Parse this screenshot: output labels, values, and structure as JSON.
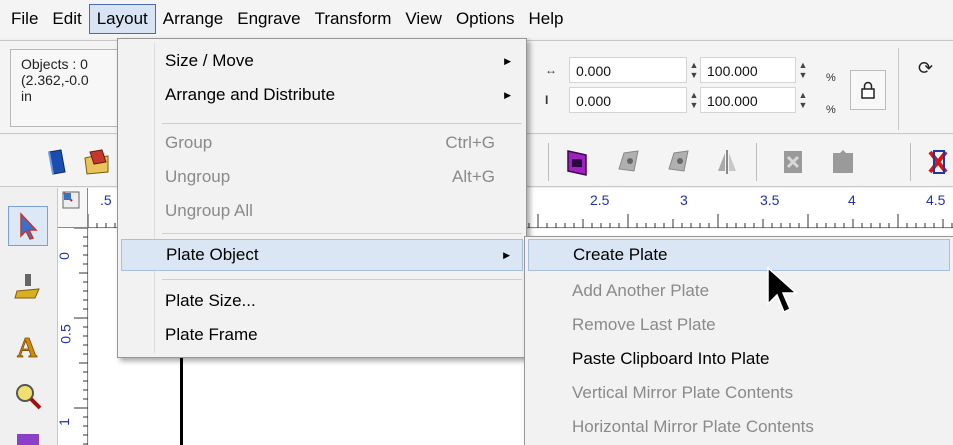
{
  "menubar": {
    "items": [
      "File",
      "Edit",
      "Layout",
      "Arrange",
      "Engrave",
      "Transform",
      "View",
      "Options",
      "Help"
    ],
    "active": "Layout"
  },
  "propbar": {
    "objects_line1": "Objects : 0",
    "objects_line2": "(2.362,-0.0",
    "objects_line3": "in",
    "x_value": "0.000",
    "y_value": "0.000",
    "w_value": "100.000",
    "h_value": "100.000",
    "percent": "%"
  },
  "ruler": {
    "top_labels": [
      ".5",
      "2.5",
      "3",
      "3.5",
      "4",
      "4.5"
    ],
    "left_labels": [
      "0",
      "0.5",
      "1"
    ]
  },
  "layout_menu": {
    "items": [
      {
        "label": "Size / Move",
        "submenu": true
      },
      {
        "label": "Arrange and Distribute",
        "submenu": true
      },
      {
        "label": "Group",
        "shortcut": "Ctrl+G",
        "disabled": true
      },
      {
        "label": "Ungroup",
        "shortcut": "Alt+G",
        "disabled": true
      },
      {
        "label": "Ungroup All",
        "disabled": true
      },
      {
        "label": "Plate Object",
        "submenu": true,
        "highlighted": true
      },
      {
        "label": "Plate Size..."
      },
      {
        "label": "Plate Frame"
      }
    ]
  },
  "plate_submenu": {
    "items": [
      {
        "label": "Create Plate",
        "highlighted": true
      },
      {
        "label": "Add Another Plate",
        "disabled": true
      },
      {
        "label": "Remove Last Plate",
        "disabled": true
      },
      {
        "label": "Paste Clipboard Into Plate"
      },
      {
        "label": "Vertical Mirror Plate Contents",
        "disabled": true
      },
      {
        "label": "Horizontal Mirror Plate Contents",
        "disabled": true
      }
    ]
  },
  "icons": {
    "submenu_arrow": "submenu-arrow-icon",
    "lock": "lock-icon",
    "rotate": "rotate-icon"
  }
}
